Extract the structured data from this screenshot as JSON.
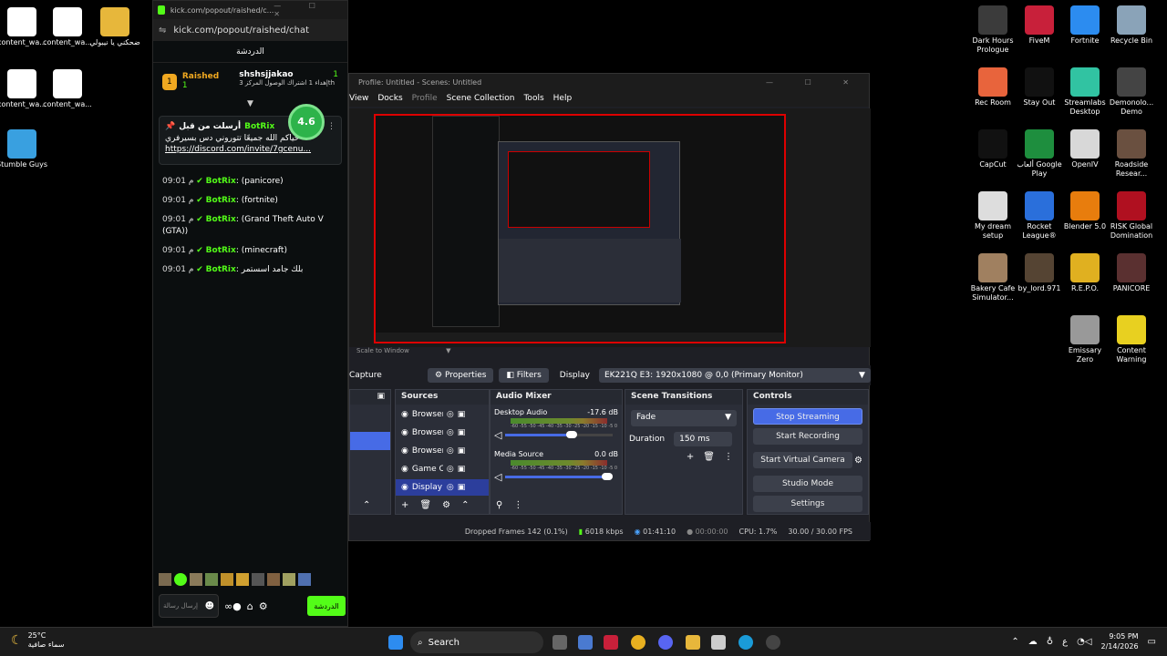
{
  "desktop_left": [
    {
      "label": "content_wa...",
      "color": "#ffffff"
    },
    {
      "label": "content_wa...",
      "color": "#ffffff"
    },
    {
      "label": "ضحكني يا نيبولي",
      "color": "#e7b73b"
    },
    {
      "label": "content_wa...",
      "color": "#ffffff"
    },
    {
      "label": "content_wa...",
      "color": "#ffffff"
    },
    {
      "label": "Stumble Guys",
      "color": "#39a0e0"
    }
  ],
  "desktop_right": [
    {
      "label": "Dark Hours Prologue",
      "color": "#3b3b3b"
    },
    {
      "label": "FiveM",
      "color": "#c8203a"
    },
    {
      "label": "Fortnite",
      "color": "#2c8cf0"
    },
    {
      "label": "Recycle Bin",
      "color": "#8aa3b8"
    },
    {
      "label": "Rec Room",
      "color": "#e8643c"
    },
    {
      "label": "Stay Out",
      "color": "#111111"
    },
    {
      "label": "Streamlabs Desktop",
      "color": "#31c3a2"
    },
    {
      "label": "Demonolo... Demo",
      "color": "#444444"
    },
    {
      "label": "CapCut",
      "color": "#111111"
    },
    {
      "label": "ألعاب Google Play",
      "color": "#1e8e3e"
    },
    {
      "label": "OpenIV",
      "color": "#d8d8d8"
    },
    {
      "label": "Roadside Resear...",
      "color": "#6a5040"
    },
    {
      "label": "My dream setup",
      "color": "#dddddd"
    },
    {
      "label": "Rocket League®",
      "color": "#2a6fdb"
    },
    {
      "label": "Blender 5.0",
      "color": "#e87d0d"
    },
    {
      "label": "RISK Global Domination",
      "color": "#b01020"
    },
    {
      "label": "Bakery Cafe Simulator...",
      "color": "#a08060"
    },
    {
      "label": "by_lord.971",
      "color": "#554433"
    },
    {
      "label": "R.E.P.O.",
      "color": "#e0b020"
    },
    {
      "label": "PANICORE",
      "color": "#5a3030"
    },
    {
      "label": "Emissary Zero",
      "color": "#999999"
    },
    {
      "label": "Content Warning",
      "color": "#e8d020"
    }
  ],
  "chat": {
    "tab_title": "kick.com/popout/raished/c...",
    "address": "kick.com/popout/raished/chat",
    "header": "الدردشة",
    "top_user": "Raished",
    "top_user_count": "1",
    "second_user": "shshsjjakao",
    "second_count": "1",
    "gift_text": "إهداء 1 اشتراك الوصول المركز 3th",
    "rating": "4.6",
    "pinned_header": "أرسلت من قبل",
    "pinned_sender": "BotRix",
    "pinned_text": "حياكم الله جميعًا تتوروني دس بسيرفري",
    "pinned_link": "https://discord.com/invite/7gcenu...",
    "messages": [
      {
        "time": "09:01 م",
        "sender": "BotRix",
        "text": ": (panicore)"
      },
      {
        "time": "09:01 م",
        "sender": "BotRix",
        "text": ": (fortnite)"
      },
      {
        "time": "09:01 م",
        "sender": "BotRix",
        "text": ": (Grand Theft Auto V (GTA))"
      },
      {
        "time": "09:01 م",
        "sender": "BotRix",
        "text": ": (minecraft)"
      },
      {
        "time": "09:01 م",
        "sender": "BotRix",
        "text": ": بلك جامد اسستمر"
      }
    ],
    "send_label": "الدردشة",
    "input_placeholder": "إرسال رسالة"
  },
  "obs": {
    "title": "Profile: Untitled - Scenes: Untitled",
    "menu": [
      "View",
      "Docks",
      "Profile",
      "Scene Collection",
      "Tools",
      "Help"
    ],
    "scale_label": "Scale to Window",
    "toolbar": {
      "capture": "Capture",
      "properties": "Properties",
      "filters": "Filters",
      "display_label": "Display",
      "display_value": "EK221Q E3: 1920x1080 @ 0,0 (Primary Monitor)"
    },
    "sources_title": "Sources",
    "sources": [
      "Browser",
      "Browser",
      "Browser",
      "Game C",
      "Display"
    ],
    "mixer_title": "Audio Mixer",
    "mixer": [
      {
        "name": "Desktop Audio",
        "db": "-17.6 dB",
        "level": 0.62
      },
      {
        "name": "Media Source",
        "db": "0.0 dB",
        "level": 0.95
      }
    ],
    "meter_ticks": "-60 -55 -50 -45 -40 -35 -30 -25 -20 -15 -10 -5 0",
    "transitions_title": "Scene Transitions",
    "transition": "Fade",
    "duration_label": "Duration",
    "duration_value": "150 ms",
    "controls_title": "Controls",
    "controls": [
      "Stop Streaming",
      "Start Recording",
      "Start Virtual Camera",
      "Studio Mode",
      "Settings"
    ],
    "status": {
      "dropped": "Dropped Frames 142 (0.1%)",
      "kbps": "6018 kbps",
      "live": "01:41:10",
      "rec": "00:00:00",
      "cpu": "CPU: 1.7%",
      "fps": "30.00 / 30.00 FPS"
    }
  },
  "taskbar": {
    "weather_temp": "25°C",
    "weather_desc": "سماء صافية",
    "search": "Search",
    "lang": "ع",
    "time": "9:05 PM",
    "date": "2/14/2026"
  }
}
